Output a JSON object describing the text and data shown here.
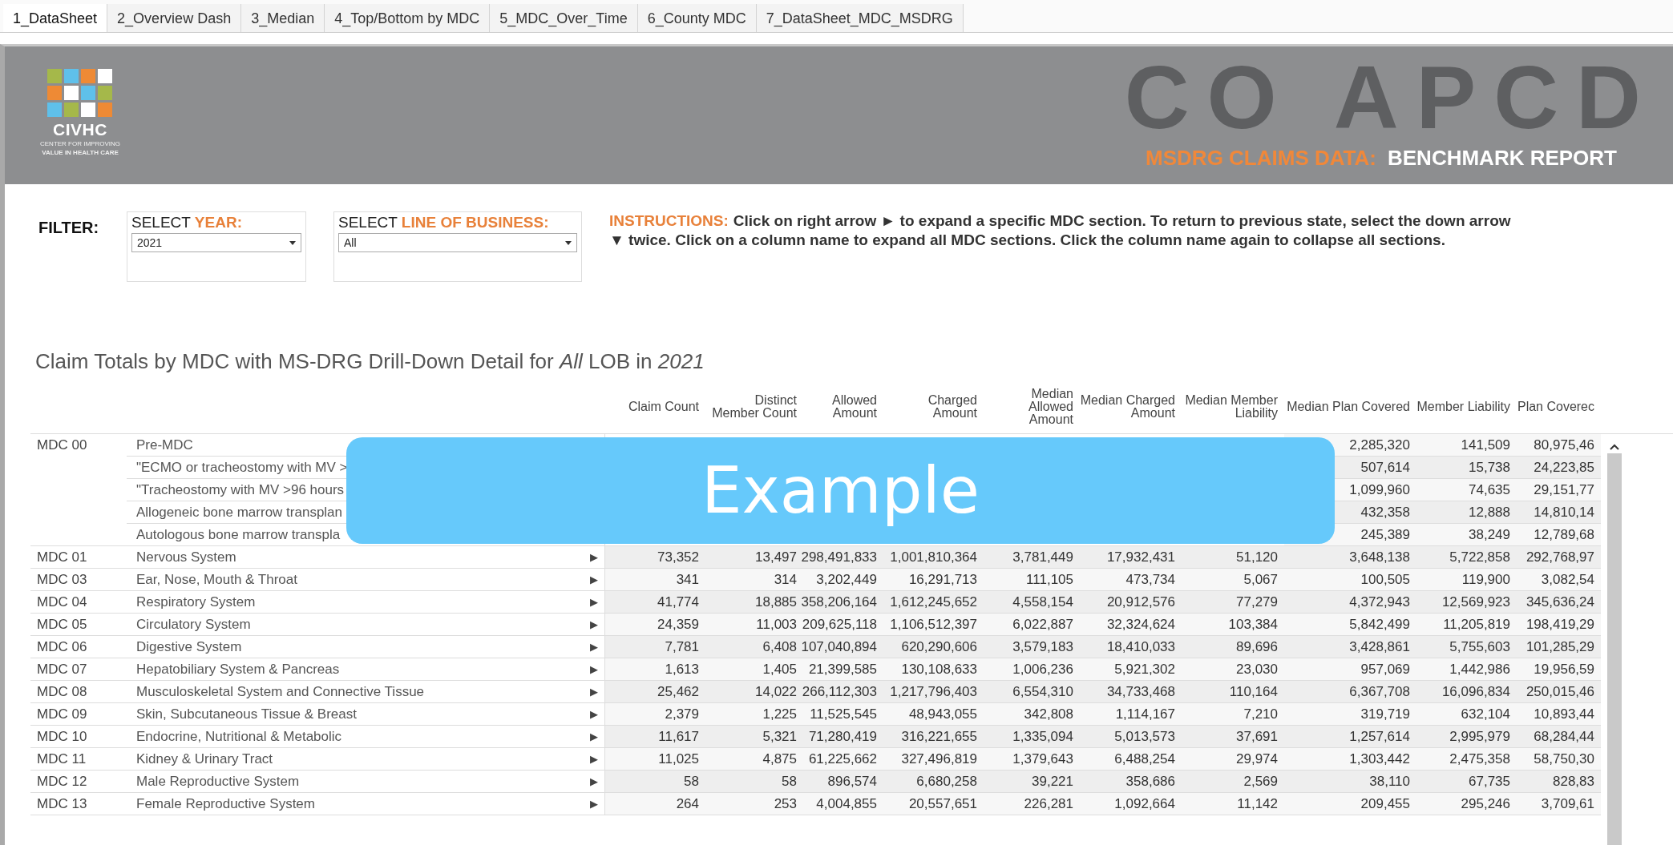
{
  "tabs": [
    {
      "label": "1_DataSheet",
      "selected": true
    },
    {
      "label": "2_Overview Dash",
      "selected": false
    },
    {
      "label": "3_Median",
      "selected": false
    },
    {
      "label": "4_Top/Bottom by MDC",
      "selected": false
    },
    {
      "label": "5_MDC_Over_Time",
      "selected": false
    },
    {
      "label": "6_County MDC",
      "selected": false
    },
    {
      "label": "7_DataSheet_MDC_MSDRG",
      "selected": false
    }
  ],
  "header": {
    "logo_name": "CIVHC",
    "logo_tagline_1": "CENTER FOR IMPROVING",
    "logo_tagline_2": "VALUE IN HEALTH CARE",
    "title": "CO APCD",
    "subtitle_label": "MSDRG CLAIMS DATA:",
    "subtitle": "BENCHMARK REPORT"
  },
  "filter": {
    "label": "FILTER:",
    "dropdowns": [
      {
        "label": "SELECT ",
        "label_highlight": "YEAR:",
        "value": "2021"
      },
      {
        "label": "SELECT ",
        "label_highlight": "LINE OF BUSINESS:",
        "value": "All"
      }
    ]
  },
  "instructions": {
    "label": "INSTRUCTIONS:",
    "text": "Click on right arrow ► to expand a specific MDC section.  To return to previous state, select the down arrow ▼ twice.  Click on a column name to expand all MDC sections. Click the column name again to collapse all sections."
  },
  "table": {
    "title": "Claim Totals by MDC with MS-DRG Drill-Down Detail for *All* LOB in *2021*",
    "columns": [
      "Claim Count",
      "Distinct Member Count",
      "Allowed Amount",
      "Charged Amount",
      "Median Allowed Amount",
      "Median Charged Amount",
      "Median Member Liability",
      "Median Plan Covered",
      "Member Liability",
      "Plan Coverec"
    ],
    "rows": [
      {
        "code": "MDC 00",
        "name": "Pre-MDC",
        "values": [
          "2,285,320",
          "141,509",
          "80,975,46"
        ],
        "children": [
          {
            "name": "\"ECMO or tracheostomy with MV >",
            "values": [
              "507,614",
              "15,738",
              "24,223,85"
            ]
          },
          {
            "name": "\"Tracheostomy with MV >96 hours",
            "values": [
              "1,099,960",
              "74,635",
              "29,151,77"
            ]
          },
          {
            "name": "Allogeneic bone marrow transplan",
            "values": [
              "432,358",
              "12,888",
              "14,810,14"
            ]
          },
          {
            "name": "Autologous bone marrow transpla",
            "values": [
              "245,389",
              "38,249",
              "12,789,68"
            ]
          }
        ]
      },
      {
        "code": "MDC 01",
        "name": "Nervous System",
        "arrow": "▶",
        "values": [
          "73,352",
          "13,497",
          "298,491,833",
          "1,001,810,364",
          "3,781,449",
          "17,932,431",
          "51,120",
          "3,648,138",
          "5,722,858",
          "292,768,97"
        ]
      },
      {
        "code": "MDC 03",
        "name": "Ear, Nose, Mouth & Throat",
        "arrow": "▶",
        "values": [
          "341",
          "314",
          "3,202,449",
          "16,291,713",
          "111,105",
          "473,734",
          "5,067",
          "100,505",
          "119,900",
          "3,082,54"
        ]
      },
      {
        "code": "MDC 04",
        "name": "Respiratory System",
        "arrow": "▶",
        "values": [
          "41,774",
          "18,885",
          "358,206,164",
          "1,612,245,652",
          "4,558,154",
          "20,912,576",
          "77,279",
          "4,372,943",
          "12,569,923",
          "345,636,24"
        ]
      },
      {
        "code": "MDC 05",
        "name": "Circulatory System",
        "arrow": "▶",
        "values": [
          "24,359",
          "11,003",
          "209,625,118",
          "1,106,512,397",
          "6,022,887",
          "32,324,624",
          "103,384",
          "5,842,499",
          "11,205,819",
          "198,419,29"
        ]
      },
      {
        "code": "MDC 06",
        "name": "Digestive System",
        "arrow": "▶",
        "values": [
          "7,781",
          "6,408",
          "107,040,894",
          "620,290,606",
          "3,579,183",
          "18,410,033",
          "89,696",
          "3,428,861",
          "5,755,603",
          "101,285,29"
        ]
      },
      {
        "code": "MDC 07",
        "name": "Hepatobiliary System & Pancreas",
        "arrow": "▶",
        "values": [
          "1,613",
          "1,405",
          "21,399,585",
          "130,108,633",
          "1,006,236",
          "5,921,302",
          "23,030",
          "957,069",
          "1,442,986",
          "19,956,59"
        ]
      },
      {
        "code": "MDC 08",
        "name": "Musculoskeletal System and Connective Tissue",
        "arrow": "▶",
        "values": [
          "25,462",
          "14,022",
          "266,112,303",
          "1,217,796,403",
          "6,554,310",
          "34,733,468",
          "110,164",
          "6,367,708",
          "16,096,834",
          "250,015,46"
        ]
      },
      {
        "code": "MDC 09",
        "name": "Skin, Subcutaneous Tissue & Breast",
        "arrow": "▶",
        "values": [
          "2,379",
          "1,225",
          "11,525,545",
          "48,943,055",
          "342,808",
          "1,114,167",
          "7,210",
          "319,719",
          "632,104",
          "10,893,44"
        ]
      },
      {
        "code": "MDC 10",
        "name": "Endocrine, Nutritional & Metabolic",
        "arrow": "▶",
        "values": [
          "11,617",
          "5,321",
          "71,280,419",
          "316,221,655",
          "1,335,094",
          "5,013,573",
          "37,691",
          "1,257,614",
          "2,995,979",
          "68,284,44"
        ]
      },
      {
        "code": "MDC 11",
        "name": "Kidney & Urinary Tract",
        "arrow": "▶",
        "values": [
          "11,025",
          "4,875",
          "61,225,662",
          "327,496,819",
          "1,379,643",
          "6,488,254",
          "29,974",
          "1,303,442",
          "2,475,358",
          "58,750,30"
        ]
      },
      {
        "code": "MDC 12",
        "name": "Male Reproductive System",
        "arrow": "▶",
        "values": [
          "58",
          "58",
          "896,574",
          "6,680,258",
          "39,221",
          "358,686",
          "2,569",
          "38,110",
          "67,735",
          "828,83"
        ]
      },
      {
        "code": "MDC 13",
        "name": "Female Reproductive System",
        "arrow": "▶",
        "values": [
          "264",
          "253",
          "4,004,855",
          "20,557,651",
          "226,281",
          "1,092,664",
          "11,142",
          "209,455",
          "295,246",
          "3,709,61"
        ]
      }
    ]
  },
  "overlay": {
    "label": "Example"
  }
}
